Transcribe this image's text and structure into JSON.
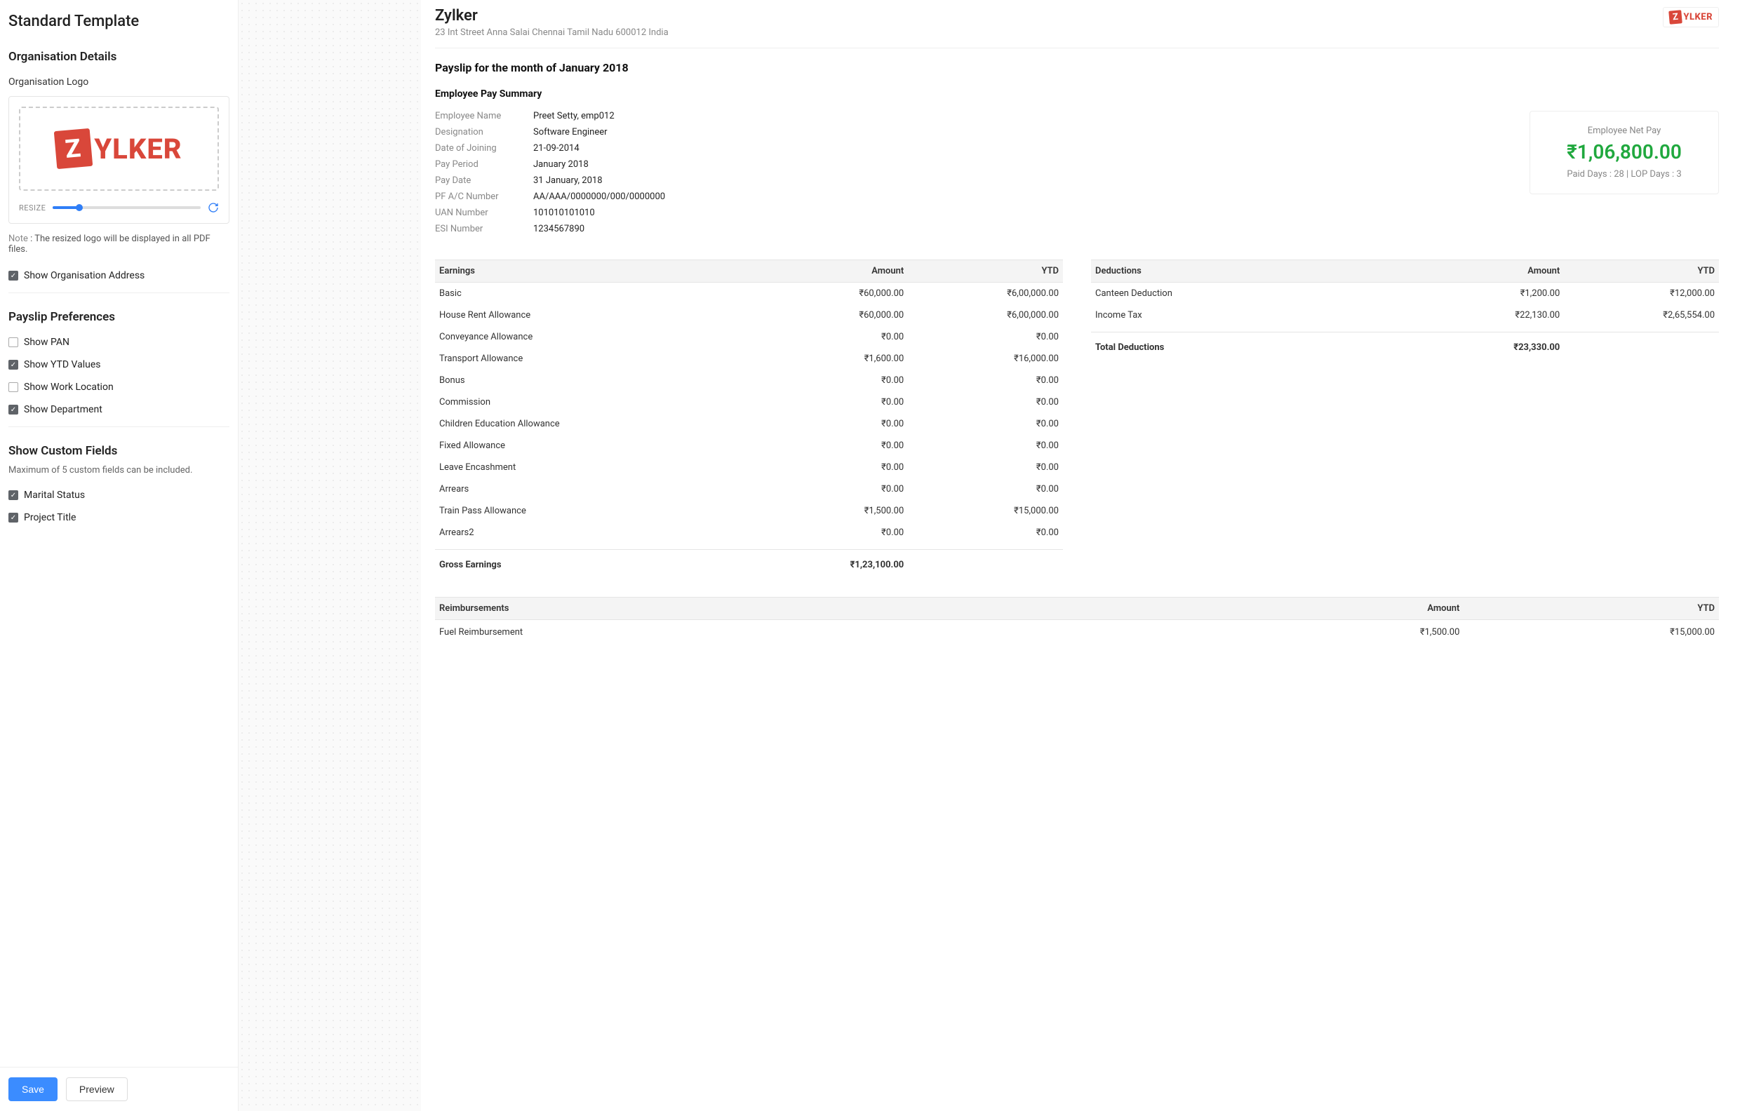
{
  "left": {
    "title": "Standard Template",
    "org_details": {
      "heading": "Organisation Details",
      "logo_label": "Organisation Logo",
      "logo_text": "YLKER",
      "resize_label": "RESIZE",
      "note_label": "Note",
      "note_text": " : The resized logo will be displayed in all PDF files.",
      "show_address": {
        "label": "Show Organisation Address",
        "checked": true
      }
    },
    "prefs": {
      "heading": "Payslip Preferences",
      "items": [
        {
          "label": "Show PAN",
          "checked": false
        },
        {
          "label": "Show YTD Values",
          "checked": true
        },
        {
          "label": "Show Work Location",
          "checked": false
        },
        {
          "label": "Show Department",
          "checked": true
        }
      ]
    },
    "custom": {
      "heading": "Show Custom Fields",
      "hint": "Maximum of 5 custom fields can be included.",
      "items": [
        {
          "label": "Marital Status",
          "checked": true
        },
        {
          "label": "Project Title",
          "checked": true
        }
      ]
    },
    "buttons": {
      "save": "Save",
      "preview": "Preview"
    }
  },
  "payslip": {
    "org_name": "Zylker",
    "org_address": "23 Int Street Anna Salai Chennai Tamil Nadu 600012 India",
    "title": "Payslip for the month of January 2018",
    "summary_title": "Employee Pay Summary",
    "fields": [
      {
        "k": "Employee Name",
        "v": "Preet Setty, emp012"
      },
      {
        "k": "Designation",
        "v": "Software Engineer"
      },
      {
        "k": "Date of Joining",
        "v": "21-09-2014"
      },
      {
        "k": "Pay Period",
        "v": "January 2018"
      },
      {
        "k": "Pay Date",
        "v": "31 January, 2018"
      },
      {
        "k": "PF A/C Number",
        "v": "AA/AAA/0000000/000/0000000"
      },
      {
        "k": "UAN Number",
        "v": "101010101010"
      },
      {
        "k": "ESI Number",
        "v": "1234567890"
      }
    ],
    "netpay": {
      "label": "Employee Net Pay",
      "amount": "₹1,06,800.00",
      "days": "Paid Days : 28 | LOP Days : 3"
    },
    "earnings": {
      "heading": "Earnings",
      "col_amount": "Amount",
      "col_ytd": "YTD",
      "rows": [
        {
          "n": "Basic",
          "a": "₹60,000.00",
          "y": "₹6,00,000.00"
        },
        {
          "n": "House Rent Allowance",
          "a": "₹60,000.00",
          "y": "₹6,00,000.00"
        },
        {
          "n": "Conveyance Allowance",
          "a": "₹0.00",
          "y": "₹0.00"
        },
        {
          "n": "Transport Allowance",
          "a": "₹1,600.00",
          "y": "₹16,000.00"
        },
        {
          "n": "Bonus",
          "a": "₹0.00",
          "y": "₹0.00"
        },
        {
          "n": "Commission",
          "a": "₹0.00",
          "y": "₹0.00"
        },
        {
          "n": "Children Education Allowance",
          "a": "₹0.00",
          "y": "₹0.00"
        },
        {
          "n": "Fixed Allowance",
          "a": "₹0.00",
          "y": "₹0.00"
        },
        {
          "n": "Leave Encashment",
          "a": "₹0.00",
          "y": "₹0.00"
        },
        {
          "n": "Arrears",
          "a": "₹0.00",
          "y": "₹0.00"
        },
        {
          "n": "Train Pass Allowance",
          "a": "₹1,500.00",
          "y": "₹15,000.00"
        },
        {
          "n": "Arrears2",
          "a": "₹0.00",
          "y": "₹0.00"
        }
      ],
      "total_label": "Gross Earnings",
      "total": "₹1,23,100.00"
    },
    "deductions": {
      "heading": "Deductions",
      "col_amount": "Amount",
      "col_ytd": "YTD",
      "rows": [
        {
          "n": "Canteen Deduction",
          "a": "₹1,200.00",
          "y": "₹12,000.00"
        },
        {
          "n": "Income Tax",
          "a": "₹22,130.00",
          "y": "₹2,65,554.00"
        }
      ],
      "total_label": "Total Deductions",
      "total": "₹23,330.00"
    },
    "reimb": {
      "heading": "Reimbursements",
      "col_amount": "Amount",
      "col_ytd": "YTD",
      "rows": [
        {
          "n": "Fuel Reimbursement",
          "a": "₹1,500.00",
          "y": "₹15,000.00"
        }
      ]
    }
  }
}
